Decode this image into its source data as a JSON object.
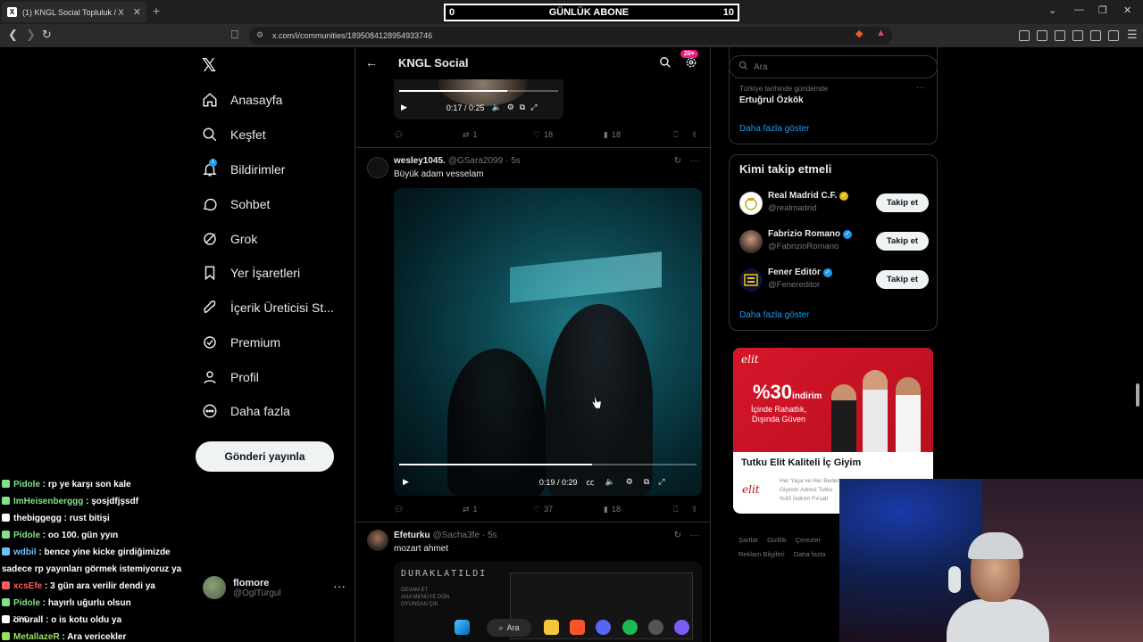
{
  "browser": {
    "tab_title": "(1) KNGL Social Topluluk / X",
    "url": "x.com/i/communities/1895084128954933746"
  },
  "overlay": {
    "left_value": "0",
    "label": "GÜNLÜK ABONE",
    "right_value": "10"
  },
  "sidebar": {
    "items": [
      {
        "label": "Anasayfa",
        "icon": "home-icon"
      },
      {
        "label": "Keşfet",
        "icon": "search-icon"
      },
      {
        "label": "Bildirimler",
        "icon": "bell-icon",
        "badge": "1"
      },
      {
        "label": "Sohbet",
        "icon": "chat-icon"
      },
      {
        "label": "Grok",
        "icon": "grok-icon"
      },
      {
        "label": "Yer İşaretleri",
        "icon": "bookmark-icon"
      },
      {
        "label": "İçerik Üreticisi St...",
        "icon": "rocket-icon"
      },
      {
        "label": "Premium",
        "icon": "premium-icon"
      },
      {
        "label": "Profil",
        "icon": "person-icon"
      },
      {
        "label": "Daha fazla",
        "icon": "more-circle-icon"
      }
    ],
    "post_button": "Gönderi yayınla",
    "account": {
      "name": "flomore",
      "handle": "@OglTurgul"
    }
  },
  "header": {
    "title": "KNGL Social",
    "badge": "20+"
  },
  "posts": [
    {
      "video_time": "0:17 / 0:25",
      "video_progress": 0.68,
      "replies": "",
      "reposts": "1",
      "likes": "18",
      "views": "18"
    },
    {
      "name": "wesley1045.",
      "handle": "@GSara2099",
      "time": "· 5s",
      "text": "Büyük adam vesselam",
      "video_time": "0:19 / 0:29",
      "video_progress": 0.65,
      "reposts": "1",
      "likes": "37",
      "views": "18"
    },
    {
      "name": "Efeturku",
      "handle": "@Sacha3fe",
      "time": "· 5s",
      "text": "mozart ahmet",
      "video_title": "DURAKLATILDI",
      "video_menu": [
        "DEVAM ET",
        "ANA MENÜYE DÖN",
        "OYUNDAN ÇIK"
      ]
    }
  ],
  "right": {
    "search_placeholder": "Ara",
    "trend": {
      "sub": "Türkiye tarihinde gündemde",
      "name": "Ertuğrul Özkök",
      "more": "Daha fazla göster"
    },
    "who_to_follow": {
      "title": "Kimi takip etmeli",
      "items": [
        {
          "name": "Real Madrid C.F.",
          "handle": "@realmadrid",
          "verified": "gold"
        },
        {
          "name": "Fabrizio Romano",
          "handle": "@FabrizioRomano",
          "verified": "blue"
        },
        {
          "name": "Fener Editör",
          "handle": "@Fenereditor",
          "verified": "blue"
        }
      ],
      "follow_label": "Takip et",
      "more": "Daha fazla göster"
    },
    "ad": {
      "brand": "elit",
      "percent": "%30",
      "percent_word": "indirim",
      "slogan_1": "İçinde Rahatlık,",
      "slogan_2": "Dışında Güven",
      "title": "Tutku Elit Kaliteli İç Giyim",
      "desc_1": "Her Yaşa ve Her Beden",
      "desc_2": "Giyimin Adresi Tutku",
      "desc_3": "%30 İndirim Fırsatı"
    },
    "footer": {
      "l1": "Şartlar",
      "l2": "Gizlilik",
      "l3": "Çerezler",
      "l4": "Reklam Bilgileri",
      "l5": "Daha fazla"
    }
  },
  "chat": [
    {
      "user": "Pidole",
      "msg": "rp ye karşı son kale",
      "color": "#7fe38a"
    },
    {
      "user": "ImHeisenberggg",
      "msg": "şosjdfjşsdf",
      "color": "#7fe38a"
    },
    {
      "user": "thebiggegg",
      "msg": "rust bitişi",
      "color": "#ffffff"
    },
    {
      "user": "Pidole",
      "msg": "oo 100. gün yyın",
      "color": "#7fe38a"
    },
    {
      "user": "wdbil",
      "msg": "bence yine kicke girdiğimizde",
      "color": "#6ec1ff"
    },
    {
      "user": "",
      "msg": "sadece rp yayınları görmek istemiyoruz ya",
      "color": "#ffffff"
    },
    {
      "user": "xcsEfe",
      "msg": "3 gün ara verilir dendi ya",
      "color": "#ff5b5b"
    },
    {
      "user": "Pidole",
      "msg": "hayırlı uğurlu olsun",
      "color": "#7fe38a"
    },
    {
      "user": "onurall",
      "msg": "o is kotu oldu ya",
      "color": "#ffffff"
    },
    {
      "user": "MetallazeR",
      "msg": "Ara vericekler",
      "color": "#9be15d"
    }
  ],
  "taskbar": {
    "search_label": "Ara",
    "weather": "22°C"
  }
}
